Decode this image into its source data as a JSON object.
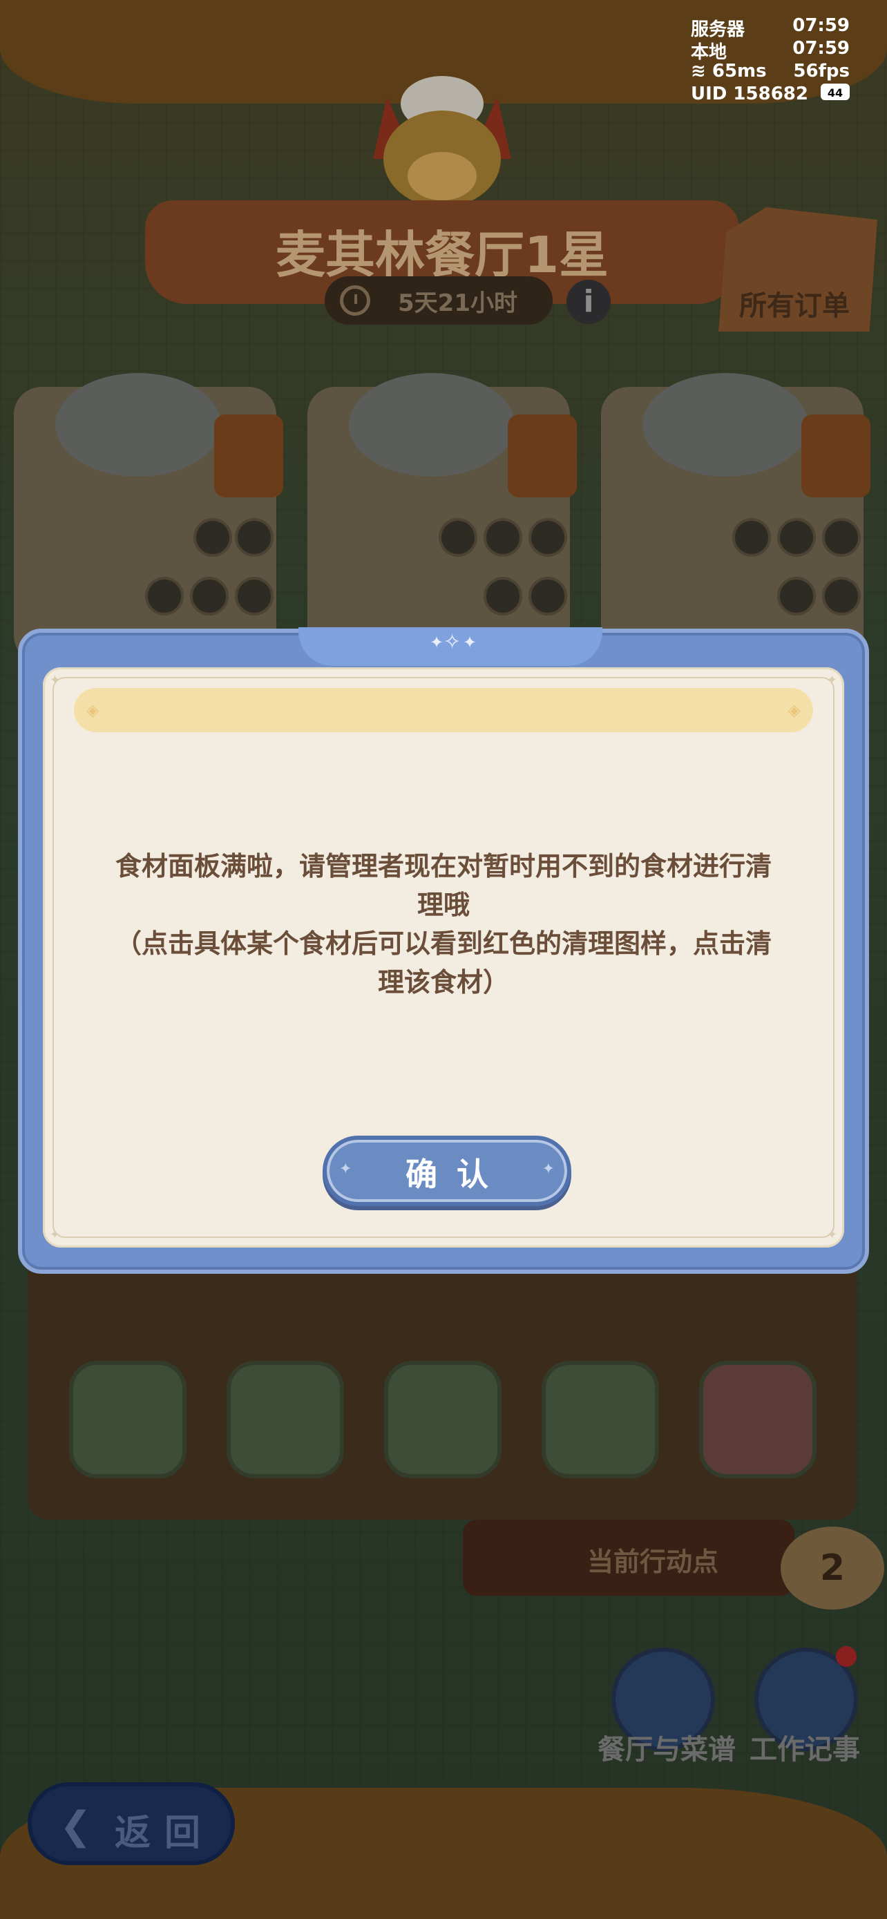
{
  "status_bar": {
    "server_label": "服务器",
    "server_time": "07:59",
    "local_label": "本地",
    "local_time": "07:59",
    "ping": "65ms",
    "fps": "56fps",
    "uid": "UID 158682",
    "battery": "44"
  },
  "header": {
    "title": "麦其林餐厅1星",
    "timer": "5天21小时",
    "info_icon": "i",
    "all_orders_label": "所有订单"
  },
  "action_points": {
    "label": "当前行动点",
    "count": "2"
  },
  "bottom_nav": {
    "recipes_label": "餐厅与菜谱",
    "work_log_label": "工作记事",
    "back_label": "返回"
  },
  "dialog": {
    "message_line1": "食材面板满啦，请管理者现在对暂时用不到的食材进行清理哦",
    "message_line2": "（点击具体某个食材后可以看到红色的清理图样，点击清理该食材）",
    "confirm_label": "确认"
  },
  "icons": {
    "back": "arrow-left-icon",
    "clock": "clock-icon",
    "info": "info-icon",
    "orders": "clipboard-icon",
    "wifi": "wifi-icon",
    "battery": "battery-icon"
  },
  "colors": {
    "dialog_frame": "#6f90cb",
    "dialog_body": "#f3ede1",
    "message_text": "#6b4e3a",
    "confirm_button": "#6b8cc3"
  }
}
